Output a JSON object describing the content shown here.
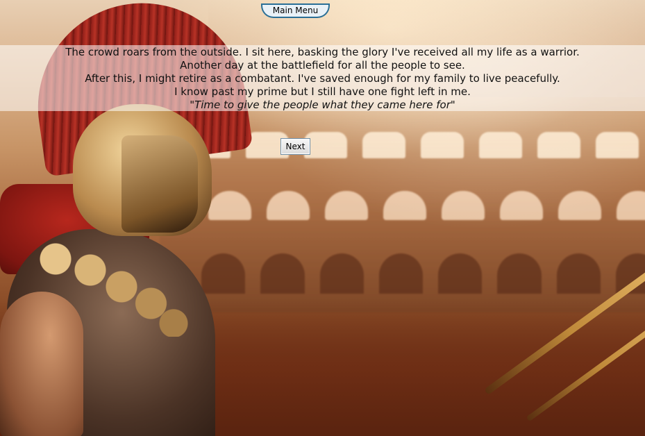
{
  "menu": {
    "main_menu_label": "Main Menu"
  },
  "story": {
    "lines": [
      "The crowd roars from the outside. I sit here, basking the glory I've received all my life as a warrior.",
      "Another day at the battlefield for all the people to see.",
      "After this, I might retire as a combatant. I've saved enough for my family to live peacefully.",
      "I know past my prime but I still have one fight left in me.",
      "\"Time to give the people what they came here for\""
    ]
  },
  "controls": {
    "next_label": "Next"
  },
  "colors": {
    "menu_border": "#2a6f96",
    "panel_overlay": "rgba(255,255,255,0.55)",
    "cape_red": "#b7271d"
  }
}
